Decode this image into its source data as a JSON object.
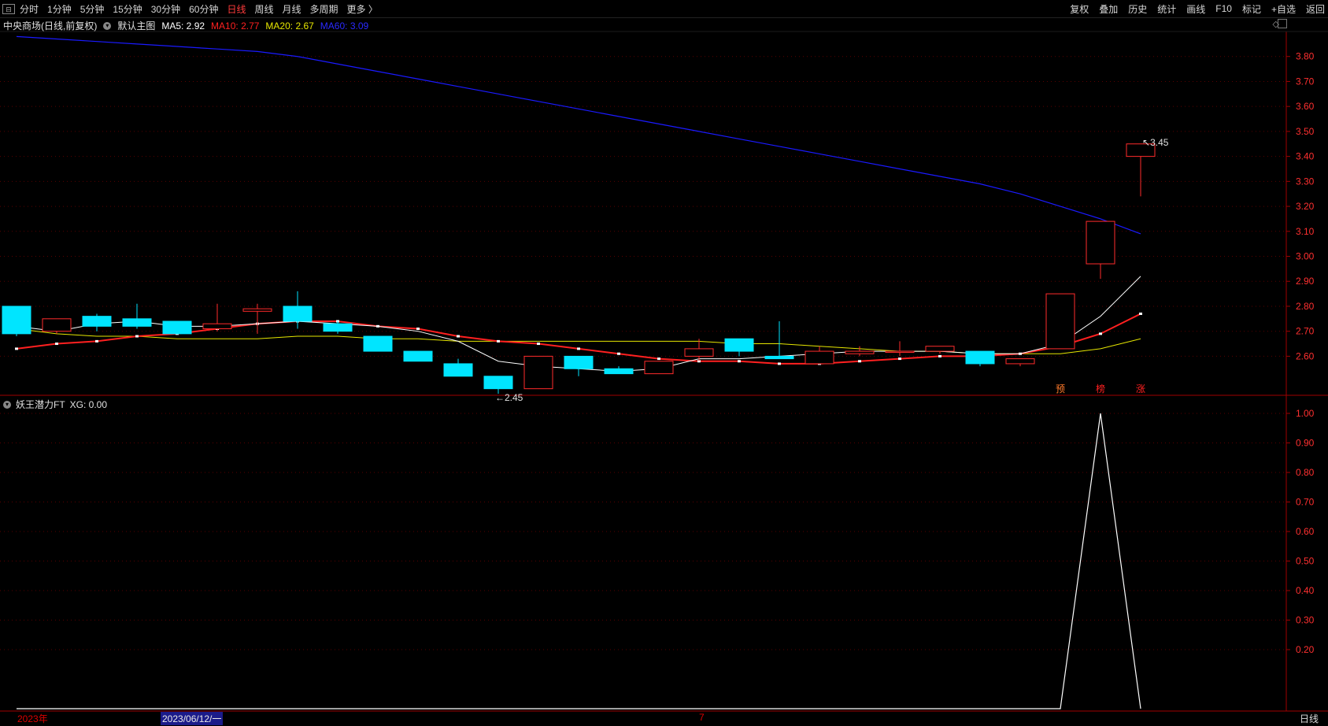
{
  "toolbar": {
    "tabs": [
      "分时",
      "1分钟",
      "5分钟",
      "15分钟",
      "30分钟",
      "60分钟",
      "日线",
      "周线",
      "月线",
      "多周期",
      "更多 〉"
    ],
    "active_tab": "日线",
    "right_buttons": [
      "复权",
      "叠加",
      "历史",
      "统计",
      "画线",
      "F10",
      "标记",
      "+自选",
      "返回"
    ]
  },
  "main_panel": {
    "title": "中央商场(日线,前复权)",
    "template": "默认主图",
    "ma5_label": "MA5: 2.92",
    "ma10_label": "MA10: 2.77",
    "ma20_label": "MA20: 2.67",
    "ma60_label": "MA60: 3.09",
    "high_marker": "3.45",
    "low_marker": "2.45",
    "signal_labels": [
      "预",
      "榜",
      "涨"
    ],
    "colors": {
      "up": "#ff2b2b",
      "down": "#00e5ff",
      "ma5": "#ffffff",
      "ma10": "#ff2020",
      "ma20": "#e6e600",
      "ma60": "#1a1aff",
      "axis": "#a00000"
    }
  },
  "sub_panel": {
    "title": "妖王潜力FT",
    "value_label": "XG: 0.00"
  },
  "bottom_axis": {
    "year_label": "2023年",
    "selected_date": "2023/06/12/一",
    "month_label": "7",
    "period": "日线"
  },
  "chart_data": [
    {
      "type": "candlestick",
      "title": "中央商场(日线,前复权)",
      "ylim": [
        2.45,
        3.9
      ],
      "y_ticks": [
        2.6,
        2.7,
        2.8,
        2.9,
        3.0,
        3.1,
        3.2,
        3.3,
        3.4,
        3.5,
        3.6,
        3.7,
        3.8
      ],
      "candles": [
        {
          "open": 2.8,
          "close": 2.69,
          "high": 2.8,
          "low": 2.68
        },
        {
          "open": 2.7,
          "close": 2.75,
          "high": 2.75,
          "low": 2.69
        },
        {
          "open": 2.76,
          "close": 2.72,
          "high": 2.77,
          "low": 2.7
        },
        {
          "open": 2.75,
          "close": 2.72,
          "high": 2.81,
          "low": 2.71
        },
        {
          "open": 2.74,
          "close": 2.69,
          "high": 2.74,
          "low": 2.69
        },
        {
          "open": 2.71,
          "close": 2.73,
          "high": 2.81,
          "low": 2.7
        },
        {
          "open": 2.78,
          "close": 2.79,
          "high": 2.81,
          "low": 2.69
        },
        {
          "open": 2.8,
          "close": 2.74,
          "high": 2.86,
          "low": 2.71
        },
        {
          "open": 2.73,
          "close": 2.7,
          "high": 2.74,
          "low": 2.69
        },
        {
          "open": 2.68,
          "close": 2.62,
          "high": 2.68,
          "low": 2.62
        },
        {
          "open": 2.62,
          "close": 2.58,
          "high": 2.62,
          "low": 2.58
        },
        {
          "open": 2.57,
          "close": 2.52,
          "high": 2.59,
          "low": 2.52
        },
        {
          "open": 2.52,
          "close": 2.47,
          "high": 2.52,
          "low": 2.45
        },
        {
          "open": 2.47,
          "close": 2.6,
          "high": 2.6,
          "low": 2.47
        },
        {
          "open": 2.6,
          "close": 2.55,
          "high": 2.6,
          "low": 2.52
        },
        {
          "open": 2.55,
          "close": 2.53,
          "high": 2.56,
          "low": 2.53
        },
        {
          "open": 2.53,
          "close": 2.58,
          "high": 2.58,
          "low": 2.53
        },
        {
          "open": 2.6,
          "close": 2.63,
          "high": 2.67,
          "low": 2.58
        },
        {
          "open": 2.67,
          "close": 2.62,
          "high": 2.67,
          "low": 2.6
        },
        {
          "open": 2.6,
          "close": 2.59,
          "high": 2.74,
          "low": 2.59
        },
        {
          "open": 2.57,
          "close": 2.62,
          "high": 2.64,
          "low": 2.57
        },
        {
          "open": 2.61,
          "close": 2.62,
          "high": 2.64,
          "low": 2.6
        },
        {
          "open": 2.62,
          "close": 2.62,
          "high": 2.66,
          "low": 2.6
        },
        {
          "open": 2.62,
          "close": 2.64,
          "high": 2.64,
          "low": 2.61
        },
        {
          "open": 2.62,
          "close": 2.57,
          "high": 2.62,
          "low": 2.56
        },
        {
          "open": 2.57,
          "close": 2.59,
          "high": 2.59,
          "low": 2.56
        },
        {
          "open": 2.63,
          "close": 2.85,
          "high": 2.85,
          "low": 2.63
        },
        {
          "open": 2.97,
          "close": 3.14,
          "high": 3.14,
          "low": 2.91
        },
        {
          "open": 3.4,
          "close": 3.45,
          "high": 3.45,
          "low": 3.24
        }
      ],
      "series": [
        {
          "name": "MA5",
          "values": [
            2.72,
            2.7,
            2.73,
            2.74,
            2.72,
            2.72,
            2.73,
            2.74,
            2.73,
            2.72,
            2.7,
            2.66,
            2.58,
            2.56,
            2.55,
            2.54,
            2.55,
            2.59,
            2.59,
            2.6,
            2.61,
            2.62,
            2.62,
            2.62,
            2.61,
            2.61,
            2.65,
            2.76,
            2.92
          ]
        },
        {
          "name": "MA10",
          "values": [
            2.63,
            2.65,
            2.66,
            2.68,
            2.69,
            2.71,
            2.73,
            2.74,
            2.74,
            2.72,
            2.71,
            2.68,
            2.66,
            2.65,
            2.63,
            2.61,
            2.59,
            2.58,
            2.58,
            2.57,
            2.57,
            2.58,
            2.59,
            2.6,
            2.6,
            2.61,
            2.64,
            2.69,
            2.77
          ]
        },
        {
          "name": "MA20",
          "values": [
            2.71,
            2.69,
            2.68,
            2.68,
            2.67,
            2.67,
            2.67,
            2.68,
            2.68,
            2.67,
            2.67,
            2.66,
            2.66,
            2.66,
            2.66,
            2.66,
            2.66,
            2.66,
            2.65,
            2.65,
            2.64,
            2.63,
            2.62,
            2.62,
            2.61,
            2.61,
            2.61,
            2.63,
            2.67
          ]
        },
        {
          "name": "MA60",
          "values": [
            3.88,
            3.87,
            3.86,
            3.85,
            3.84,
            3.83,
            3.82,
            3.8,
            3.77,
            3.74,
            3.71,
            3.68,
            3.65,
            3.62,
            3.59,
            3.56,
            3.53,
            3.5,
            3.47,
            3.44,
            3.41,
            3.38,
            3.35,
            3.32,
            3.29,
            3.25,
            3.2,
            3.15,
            3.09
          ]
        }
      ]
    },
    {
      "type": "line",
      "title": "妖王潜力FT",
      "ylim": [
        0,
        1.0
      ],
      "y_ticks": [
        0.2,
        0.3,
        0.4,
        0.5,
        0.6,
        0.7,
        0.8,
        0.9,
        1.0
      ],
      "series": [
        {
          "name": "XG",
          "values": [
            0,
            0,
            0,
            0,
            0,
            0,
            0,
            0,
            0,
            0,
            0,
            0,
            0,
            0,
            0,
            0,
            0,
            0,
            0,
            0,
            0,
            0,
            0,
            0,
            0,
            0,
            0,
            1,
            0
          ]
        }
      ]
    }
  ]
}
